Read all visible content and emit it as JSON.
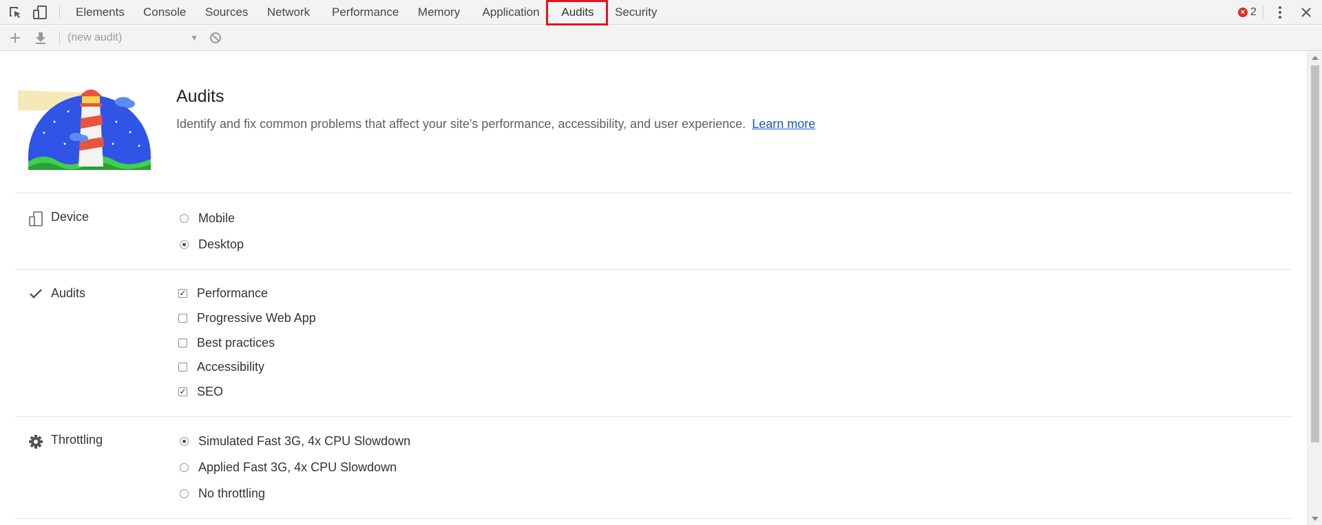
{
  "tabbar": {
    "tabs": [
      {
        "label": "Elements"
      },
      {
        "label": "Console"
      },
      {
        "label": "Sources"
      },
      {
        "label": "Network"
      },
      {
        "label": "Performance"
      },
      {
        "label": "Memory"
      },
      {
        "label": "Application"
      },
      {
        "label": "Audits",
        "active": true
      },
      {
        "label": "Security"
      }
    ],
    "error_count": "2",
    "highlight_color": "#e1141e"
  },
  "toolbar": {
    "audit_select_value": "(new audit)"
  },
  "header": {
    "title": "Audits",
    "description": "Identify and fix common problems that affect your site's performance, accessibility, and user experience.",
    "learn_more": "Learn more"
  },
  "sections": {
    "device": {
      "label": "Device",
      "options": [
        {
          "label": "Mobile",
          "selected": false
        },
        {
          "label": "Desktop",
          "selected": true
        }
      ]
    },
    "audits": {
      "label": "Audits",
      "options": [
        {
          "label": "Performance",
          "checked": true
        },
        {
          "label": "Progressive Web App",
          "checked": false
        },
        {
          "label": "Best practices",
          "checked": false
        },
        {
          "label": "Accessibility",
          "checked": false
        },
        {
          "label": "SEO",
          "checked": true
        }
      ]
    },
    "throttling": {
      "label": "Throttling",
      "options": [
        {
          "label": "Simulated Fast 3G, 4x CPU Slowdown",
          "selected": true
        },
        {
          "label": "Applied Fast 3G, 4x CPU Slowdown",
          "selected": false
        },
        {
          "label": "No throttling",
          "selected": false
        }
      ]
    }
  }
}
